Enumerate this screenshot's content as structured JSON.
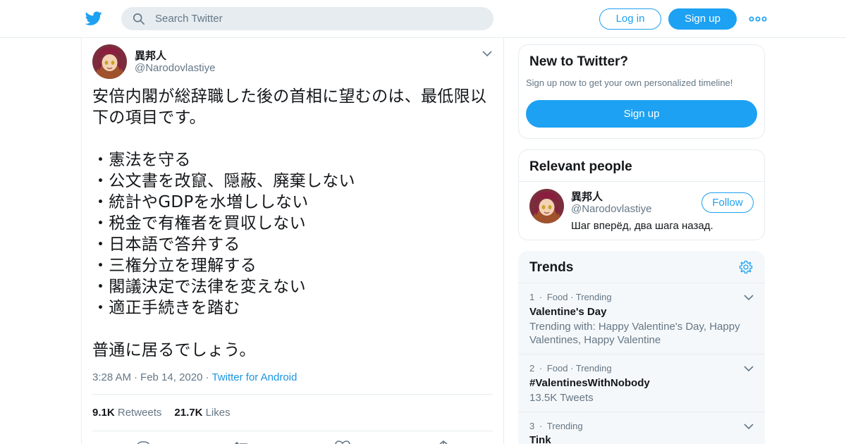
{
  "header": {
    "logo_icon": "twitter-bird-icon",
    "search_placeholder": "Search Twitter",
    "login_label": "Log in",
    "signup_label": "Sign up",
    "more_icon": "more-dots-icon",
    "brand_color": "#1da1f2"
  },
  "tweet": {
    "author_name": "異邦人",
    "author_handle": "@Narodovlastiye",
    "text": "安倍内閣が総辞職した後の首相に望むのは、最低限以下の項目です。\n\n・憲法を守る\n・公文書を改竄、隠蔽、廃棄しない\n・統計やGDPを水増ししない\n・税金で有権者を買収しない\n・日本語で答弁する\n・三権分立を理解する\n・閣議決定で法律を変えない\n・適正手続きを踏む\n\n普通に居るでしょう。",
    "time": "3:28 AM",
    "date": "Feb 14, 2020",
    "source": "Twitter for Android",
    "separator": "·",
    "retweets_count": "9.1K",
    "retweets_label": "Retweets",
    "likes_count": "21.7K",
    "likes_label": "Likes"
  },
  "sidebar": {
    "new_to_twitter": {
      "title": "New to Twitter?",
      "subtitle": "Sign up now to get your own personalized timeline!",
      "button": "Sign up"
    },
    "relevant_people": {
      "title": "Relevant people",
      "name": "異邦人",
      "handle": "@Narodovlastiye",
      "bio": "Шаг вперёд, два шага назад.",
      "follow": "Follow"
    },
    "trends": {
      "title": "Trends",
      "items": [
        {
          "rank": "1",
          "category": "Food · Trending",
          "name": "Valentine's Day",
          "desc": "Trending with: Happy Valentine's Day, Happy Valentines, Happy Valentine"
        },
        {
          "rank": "2",
          "category": "Food · Trending",
          "name": "#ValentinesWithNobody",
          "desc": "13.5K Tweets"
        },
        {
          "rank": "3",
          "category": "Trending",
          "name": "Tink",
          "desc": ""
        }
      ]
    }
  }
}
